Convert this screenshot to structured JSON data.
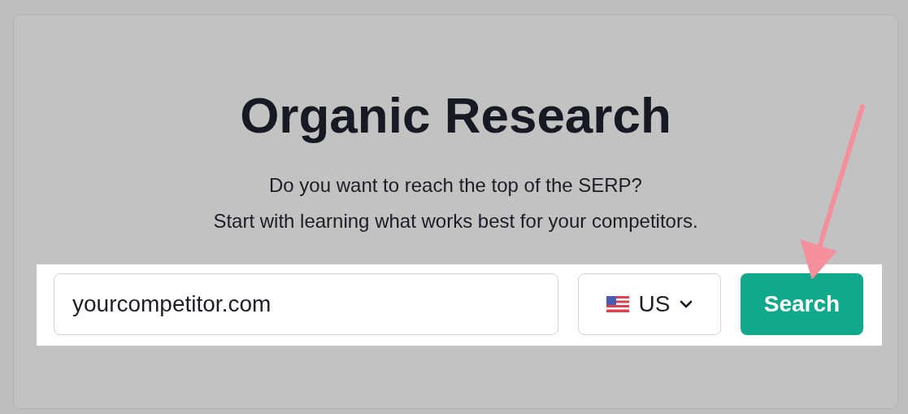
{
  "title": "Organic Research",
  "subtitle_lines": [
    "Do you want to reach the top of the SERP?",
    "Start with learning what works best for your competitors."
  ],
  "search_bar": {
    "domain_value": "yourcompetitor.com",
    "country": "US",
    "button": "Search"
  }
}
